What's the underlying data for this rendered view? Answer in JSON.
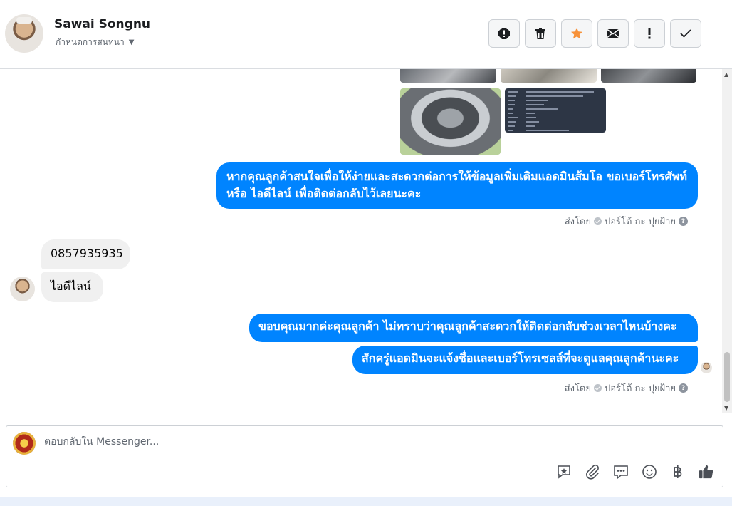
{
  "contact": {
    "name": "Sawai Songnu",
    "assign_label": "กำหนดการสนทนา"
  },
  "toolbar": {
    "buttons": [
      {
        "name": "report-spam-button",
        "icon": "alert-circle-icon"
      },
      {
        "name": "delete-button",
        "icon": "trash-icon"
      },
      {
        "name": "star-button",
        "icon": "star-icon",
        "color": "#f7923a"
      },
      {
        "name": "mark-unread-button",
        "icon": "envelope-icon"
      },
      {
        "name": "follow-up-button",
        "icon": "exclamation-icon"
      },
      {
        "name": "mark-done-button",
        "icon": "check-icon"
      }
    ]
  },
  "messages": {
    "m1": "หากคุณลูกค้าสนใจเพื่อให้ง่ายและสะดวกต่อการให้ข้อมูลเพิ่มเติมแอดมินส้มโอ ขอเบอร์โทรศัพท์ หรือ ไอดีไลน์ เพื่อติดต่อกลับไว้เลยนะคะ",
    "in1": "0857935935",
    "in2": "ไอดีไลน์",
    "m2": "ขอบคุณมากค่ะคุณลูกค้า ไม่ทราบว่าคุณลูกค้าสะดวกให้ติดต่อกลับช่วงเวลาไหนบ้างคะ",
    "m3": "สักครู่แอดมินจะแจ้งชื่อและเบอร์โทรเซลส์ที่จะดูแลคุณลูกค้านะคะ"
  },
  "sent_by": {
    "prefix": "ส่งโดย",
    "sender": "ปอร์โต้ กะ ปุยฝ้าย",
    "help": "?"
  },
  "composer": {
    "placeholder": "ตอบกลับใน Messenger..."
  },
  "colors": {
    "brand_blue": "#0084ff",
    "incoming_bg": "#f0f0f0",
    "star": "#f7923a"
  }
}
